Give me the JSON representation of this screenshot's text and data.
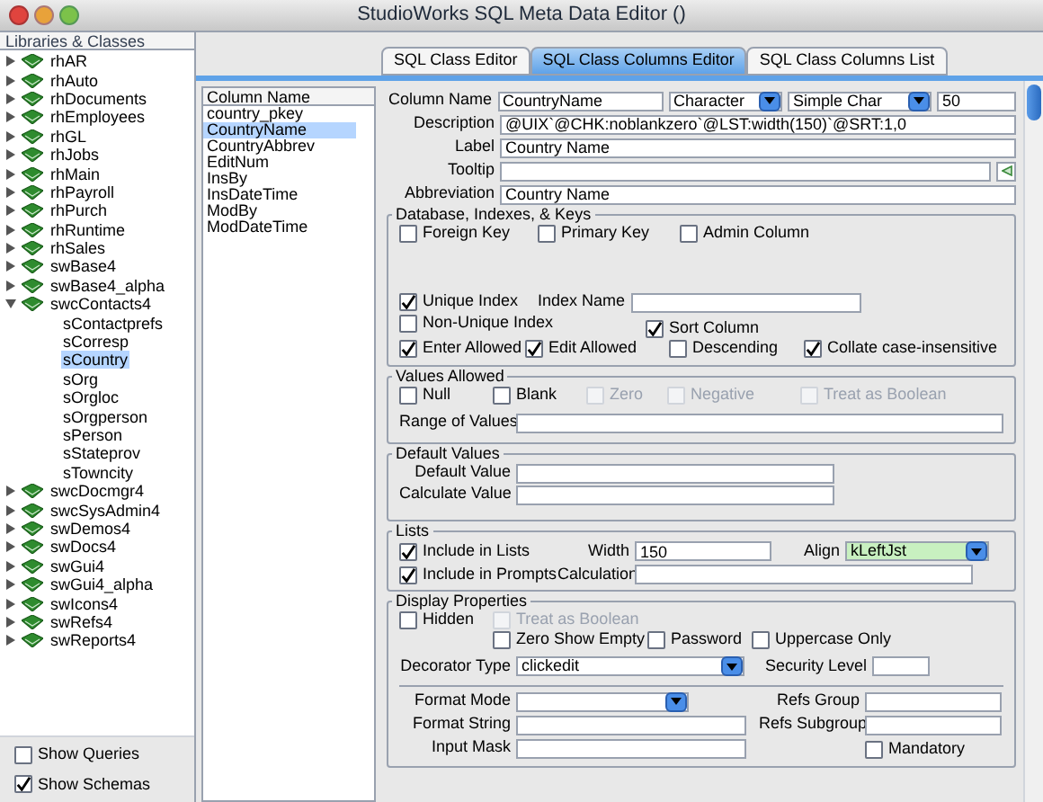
{
  "window": {
    "title": "StudioWorks SQL Meta Data Editor ()"
  },
  "libraries": {
    "header": "Libraries & Classes",
    "items": [
      {
        "label": "rhAR",
        "expanded": false,
        "selected": false
      },
      {
        "label": "rhAuto",
        "expanded": false,
        "selected": false
      },
      {
        "label": "rhDocuments",
        "expanded": false,
        "selected": false
      },
      {
        "label": "rhEmployees",
        "expanded": false,
        "selected": false
      },
      {
        "label": "rhGL",
        "expanded": false,
        "selected": false
      },
      {
        "label": "rhJobs",
        "expanded": false,
        "selected": false
      },
      {
        "label": "rhMain",
        "expanded": false,
        "selected": false
      },
      {
        "label": "rhPayroll",
        "expanded": false,
        "selected": false
      },
      {
        "label": "rhPurch",
        "expanded": false,
        "selected": false
      },
      {
        "label": "rhRuntime",
        "expanded": false,
        "selected": false
      },
      {
        "label": "rhSales",
        "expanded": false,
        "selected": false
      },
      {
        "label": "swBase4",
        "expanded": false,
        "selected": false
      },
      {
        "label": "swBase4_alpha",
        "expanded": false,
        "selected": false
      },
      {
        "label": "swcContacts4",
        "expanded": true,
        "selected": false,
        "children": [
          {
            "label": "sContactprefs",
            "selected": false
          },
          {
            "label": "sCorresp",
            "selected": false
          },
          {
            "label": "sCountry",
            "selected": true
          },
          {
            "label": "sOrg",
            "selected": false
          },
          {
            "label": "sOrgloc",
            "selected": false
          },
          {
            "label": "sOrgperson",
            "selected": false
          },
          {
            "label": "sPerson",
            "selected": false
          },
          {
            "label": "sStateprov",
            "selected": false
          },
          {
            "label": "sTowncity",
            "selected": false
          }
        ]
      },
      {
        "label": "swcDocmgr4",
        "expanded": false,
        "selected": false
      },
      {
        "label": "swcSysAdmin4",
        "expanded": false,
        "selected": false
      },
      {
        "label": "swDemos4",
        "expanded": false,
        "selected": false
      },
      {
        "label": "swDocs4",
        "expanded": false,
        "selected": false
      },
      {
        "label": "swGui4",
        "expanded": false,
        "selected": false
      },
      {
        "label": "swGui4_alpha",
        "expanded": false,
        "selected": false
      },
      {
        "label": "swIcons4",
        "expanded": false,
        "selected": false
      },
      {
        "label": "swRefs4",
        "expanded": false,
        "selected": false
      },
      {
        "label": "swReports4",
        "expanded": false,
        "selected": false
      }
    ]
  },
  "options": [
    {
      "label": "Show Queries",
      "checked": false
    },
    {
      "label": "Show Schemas",
      "checked": true
    }
  ],
  "tabs": [
    {
      "label": "SQL Class Editor",
      "selected": false
    },
    {
      "label": "SQL Class Columns Editor",
      "selected": true
    },
    {
      "label": "SQL Class Columns List",
      "selected": false
    }
  ],
  "column_list": {
    "header": "Column Name",
    "items": [
      {
        "label": "country_pkey",
        "selected": false
      },
      {
        "label": "CountryName",
        "selected": true
      },
      {
        "label": "CountryAbbrev",
        "selected": false
      },
      {
        "label": "EditNum",
        "selected": false
      },
      {
        "label": "InsBy",
        "selected": false
      },
      {
        "label": "InsDateTime",
        "selected": false
      },
      {
        "label": "ModBy",
        "selected": false
      },
      {
        "label": "ModDateTime",
        "selected": false
      }
    ]
  },
  "column": {
    "name": {
      "label": "Column Name",
      "value": "CountryName"
    },
    "type": "Character",
    "subtype": "Simple Char",
    "length": "50",
    "description": {
      "label": "Description",
      "value": "@UIX`@CHK:noblankzero`@LST:width(150)`@SRT:1,0"
    },
    "caption": {
      "label": "Label",
      "value": "Country Name"
    },
    "tooltip": {
      "label": "Tooltip"
    },
    "abbreviation": {
      "label": "Abbreviation",
      "value": "Country Name"
    }
  },
  "database": {
    "title": "Database, Indexes, & Keys",
    "foreign_key": {
      "label": "Foreign Key",
      "checked": false,
      "disabled": false
    },
    "primary_key": {
      "label": "Primary Key",
      "checked": false,
      "disabled": false
    },
    "admin_column": {
      "label": "Admin Column",
      "checked": false,
      "disabled": false
    },
    "unique_index": {
      "label": "Unique Index",
      "checked": true,
      "disabled": false
    },
    "index_name": {
      "label": "Index Name"
    },
    "non_unique_index": {
      "label": "Non-Unique Index",
      "checked": false,
      "disabled": false
    },
    "sort_column": {
      "label": "Sort Column",
      "checked": true,
      "disabled": false
    },
    "enter_allowed": {
      "label": "Enter Allowed",
      "checked": true,
      "disabled": false
    },
    "edit_allowed": {
      "label": "Edit Allowed",
      "checked": true,
      "disabled": false
    },
    "descending": {
      "label": "Descending",
      "checked": false,
      "disabled": false
    },
    "collate": {
      "label": "Collate case-insensitive",
      "checked": true,
      "disabled": false
    }
  },
  "values_allowed": {
    "title": "Values Allowed",
    "checks": [
      {
        "label": "Null",
        "checked": false,
        "disabled": false
      },
      {
        "label": "Blank",
        "checked": false,
        "disabled": false
      },
      {
        "label": "Zero",
        "checked": false,
        "disabled": true
      },
      {
        "label": "Negative",
        "checked": false,
        "disabled": true
      },
      {
        "label": "Treat as Boolean",
        "checked": false,
        "disabled": true
      }
    ],
    "range": {
      "label": "Range of Values"
    }
  },
  "default_values": {
    "title": "Default Values",
    "default": {
      "label": "Default Value"
    },
    "calculate": {
      "label": "Calculate Value"
    }
  },
  "lists": {
    "title": "Lists",
    "include_lists": {
      "label": "Include in Lists",
      "checked": true,
      "disabled": false
    },
    "width": {
      "label": "Width",
      "value": "150"
    },
    "align": {
      "label": "Align",
      "value": "kLeftJst"
    },
    "include_prompts": {
      "label": "Include in Prompts",
      "checked": true,
      "disabled": false
    },
    "calculation": {
      "label": "Calculation"
    }
  },
  "display": {
    "title": "Display Properties",
    "hidden": {
      "label": "Hidden",
      "checked": false,
      "disabled": false
    },
    "treat_boolean": {
      "label": "Treat as Boolean",
      "checked": false,
      "disabled": true
    },
    "zero_empty": {
      "label": "Zero Show Empty",
      "checked": false,
      "disabled": false
    },
    "password": {
      "label": "Password",
      "checked": false,
      "disabled": false
    },
    "uppercase": {
      "label": "Uppercase Only",
      "checked": false,
      "disabled": false
    },
    "decorator": {
      "label": "Decorator Type",
      "value": "clickedit"
    },
    "security": {
      "label": "Security Level"
    },
    "format_mode": {
      "label": "Format Mode"
    },
    "format_string": {
      "label": "Format String"
    },
    "input_mask": {
      "label": "Input Mask"
    },
    "refs_group": {
      "label": "Refs Group"
    },
    "refs_subgroup": {
      "label": "Refs Subgroup"
    },
    "mandatory": {
      "label": "Mandatory",
      "checked": false,
      "disabled": false
    }
  }
}
